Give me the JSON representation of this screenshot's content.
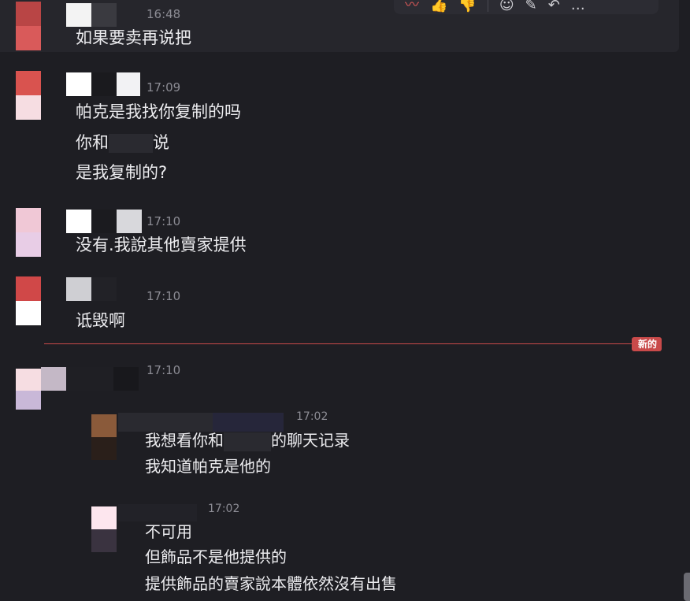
{
  "toolbar": {
    "icons": [
      "reaction-icon",
      "thumbs-up-icon",
      "thumbs-down-icon",
      "emoji-icon",
      "edit-icon",
      "reply-icon",
      "more-icon"
    ],
    "symbols": [
      "〰",
      "👍",
      "👎",
      "☺",
      "✎",
      "↶",
      "…"
    ]
  },
  "messages": [
    {
      "time": "16:48",
      "lines": [
        "如果要卖再说把"
      ]
    },
    {
      "time": "17:09",
      "lines": [
        "帕克是我找你复制的吗",
        "你和",
        "说",
        "是我复制的?"
      ]
    },
    {
      "time": "17:10",
      "lines": [
        "没有.我說其他賣家提供"
      ]
    },
    {
      "time": "17:10",
      "lines": [
        "诋毁啊"
      ]
    },
    {
      "time": "17:10",
      "lines": []
    }
  ],
  "new_divider": {
    "label": "新的",
    "color": "#c94a4a"
  },
  "replies": [
    {
      "time": "17:02",
      "lines": [
        "我想看你和",
        "的聊天记录",
        "我知道帕克是他的"
      ]
    },
    {
      "time": "17:02",
      "lines": [
        "不可用",
        "但飾品不是他提供的",
        "提供飾品的賣家說本體依然沒有出售"
      ]
    }
  ]
}
